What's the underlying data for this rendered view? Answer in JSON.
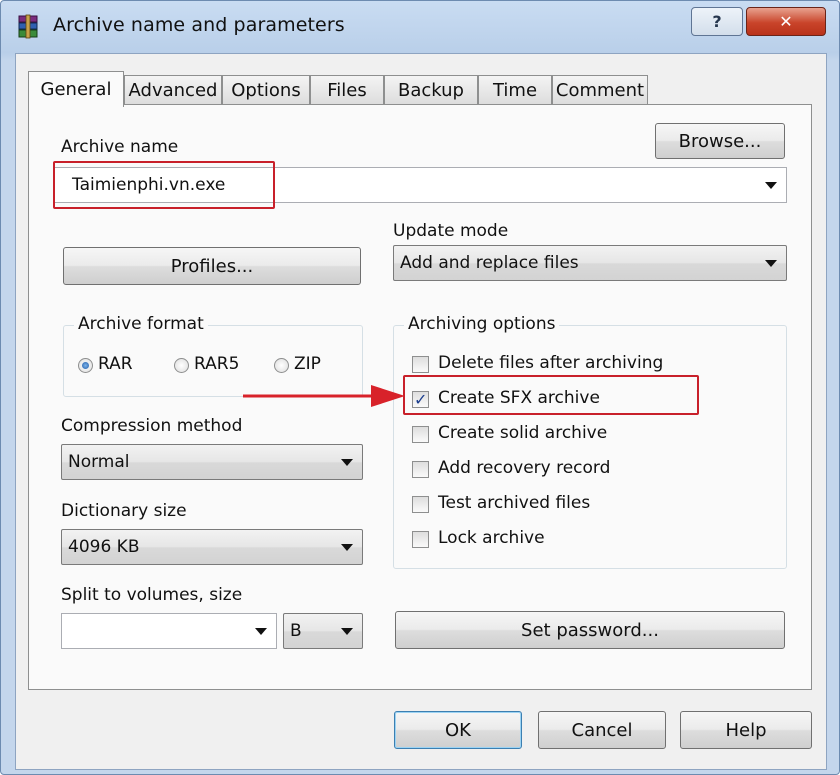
{
  "window": {
    "title": "Archive name and parameters",
    "help_button": "?",
    "close_button": "✕"
  },
  "tabs": [
    "General",
    "Advanced",
    "Options",
    "Files",
    "Backup",
    "Time",
    "Comment"
  ],
  "active_tab": "General",
  "archive_name": {
    "label": "Archive name",
    "value": "Taimienphi.vn.exe",
    "browse_button": "Browse..."
  },
  "update_mode": {
    "label": "Update mode",
    "value": "Add and replace files"
  },
  "profiles_button": "Profiles...",
  "archive_format": {
    "title": "Archive format",
    "options": [
      "RAR",
      "RAR5",
      "ZIP"
    ],
    "selected": "RAR"
  },
  "archiving_options": {
    "title": "Archiving options",
    "items": [
      {
        "label": "Delete files after archiving",
        "checked": false
      },
      {
        "label": "Create SFX archive",
        "checked": true
      },
      {
        "label": "Create solid archive",
        "checked": false
      },
      {
        "label": "Add recovery record",
        "checked": false
      },
      {
        "label": "Test archived files",
        "checked": false
      },
      {
        "label": "Lock archive",
        "checked": false
      }
    ]
  },
  "compression_method": {
    "label": "Compression method",
    "value": "Normal"
  },
  "dictionary_size": {
    "label": "Dictionary size",
    "value": "4096 KB"
  },
  "split_volumes": {
    "label": "Split to volumes, size",
    "size_value": "",
    "unit_value": "B"
  },
  "set_password_button": "Set password...",
  "footer": {
    "ok": "OK",
    "cancel": "Cancel",
    "help": "Help"
  },
  "annotation_color": "#c8202a"
}
